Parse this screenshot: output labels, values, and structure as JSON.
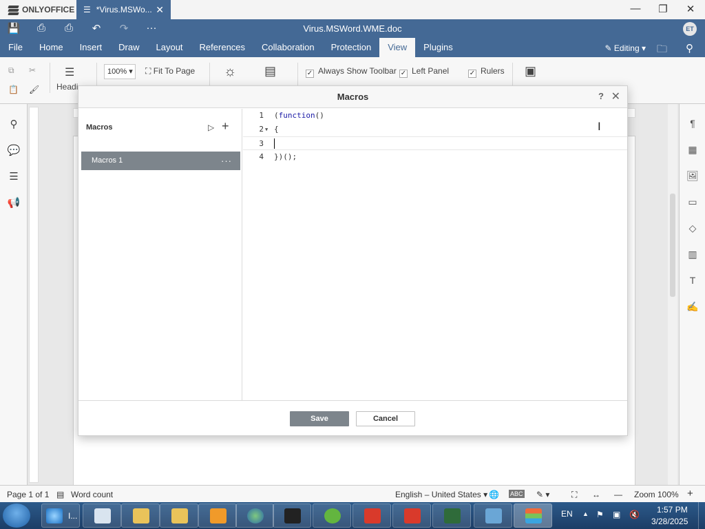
{
  "app": {
    "brand": "ONLYOFFICE",
    "tab_title": "*Virus.MSWo...",
    "doc_title": "Virus.MSWord.WME.doc",
    "user_initials": "ET"
  },
  "menu": [
    "File",
    "Home",
    "Insert",
    "Draw",
    "Layout",
    "References",
    "Collaboration",
    "Protection",
    "View",
    "Plugins"
  ],
  "menu_active": "View",
  "editing_label": "Editing",
  "toolbar": {
    "headings_label": "Headi",
    "zoom_value": "100%",
    "fit_to_page": "Fit To Page",
    "always_show_toolbar": "Always Show Toolbar",
    "left_panel": "Left Panel",
    "rulers": "Rulers"
  },
  "dialog": {
    "title": "Macros",
    "help": "?",
    "list_header": "Macros",
    "macros": [
      {
        "name": "Macros 1"
      }
    ],
    "code_lines": [
      {
        "num": "1",
        "text": "(function()"
      },
      {
        "num": "2",
        "text": "{"
      },
      {
        "num": "3",
        "text": ""
      },
      {
        "num": "4",
        "text": "})();"
      }
    ],
    "save_label": "Save",
    "cancel_label": "Cancel"
  },
  "status": {
    "page": "Page 1 of 1",
    "word_count": "Word count",
    "language": "English – United States",
    "zoom": "Zoom 100%"
  },
  "taskbar": {
    "lang": "EN",
    "time": "1:57 PM",
    "date": "3/28/2025",
    "ie_label": "I..."
  }
}
